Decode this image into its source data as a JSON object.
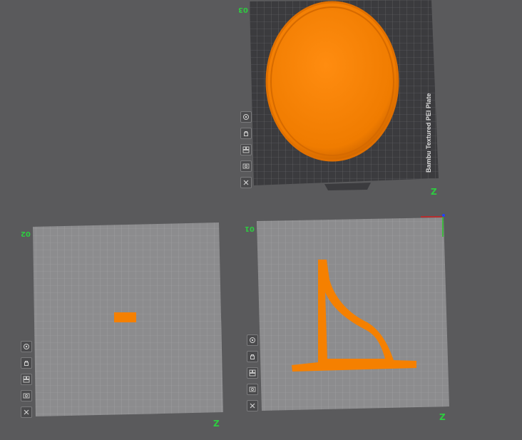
{
  "plates": [
    {
      "id": "plate-1",
      "number": "01",
      "z_label": "Z"
    },
    {
      "id": "plate-2",
      "number": "02",
      "z_label": "Z"
    },
    {
      "id": "plate-3",
      "number": "03",
      "z_label": "Z",
      "brand": "Bambu Textured PEI Plate"
    }
  ],
  "plate_tools": [
    {
      "name": "auto-orient-icon"
    },
    {
      "name": "lock-icon"
    },
    {
      "name": "arrange-icon"
    },
    {
      "name": "plate-settings-icon"
    },
    {
      "name": "delete-plate-icon"
    }
  ],
  "colors": {
    "background": "#5a5a5c",
    "plate_grid": "#8c8c8e",
    "plate_textured": "#3b3b3e",
    "model": "#f58000",
    "label_green": "#2ecc40"
  }
}
